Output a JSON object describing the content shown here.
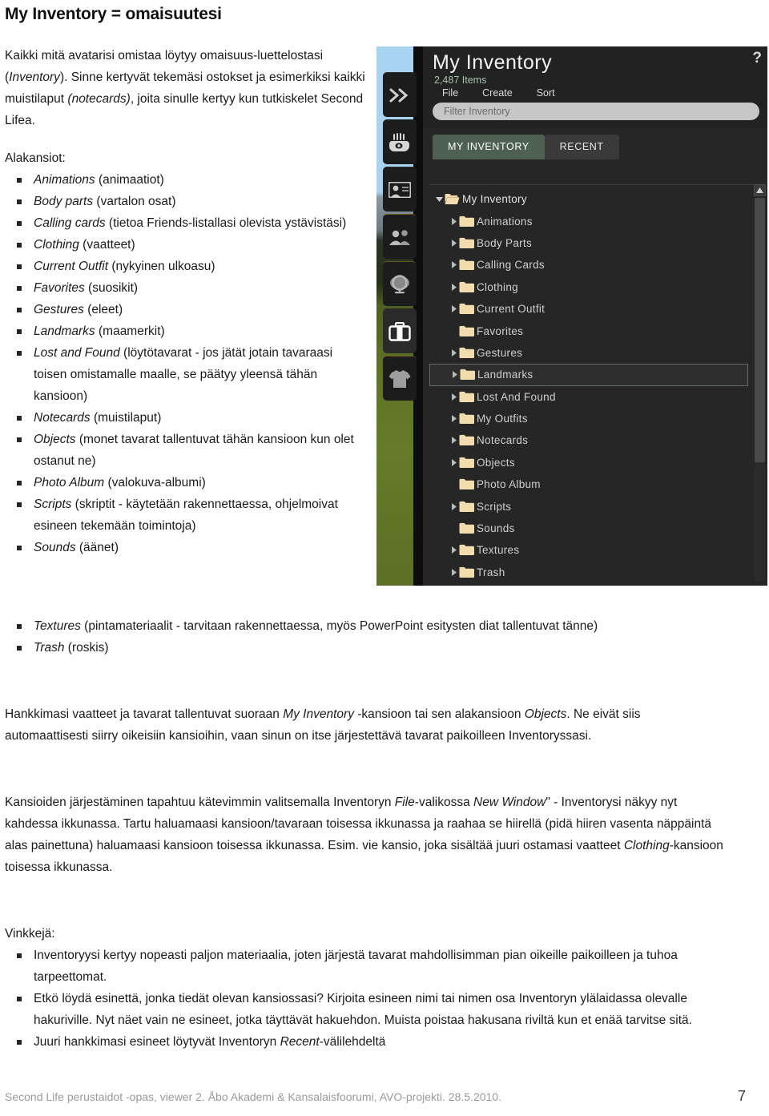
{
  "document": {
    "title": "My Inventory = omaisuutesi",
    "intro_paragraph": "Kaikki mitä avatarisi omistaa löytyy omaisuus-luettelostasi (Inventory). Sinne kertyvät tekemäsi ostokset ja esimerkiksi kaikki muistilaput (notecards), joita sinulle kertyy kun tutkiskelet Second Lifea.",
    "subfolders_label": "Alakansiot:",
    "tips_label": "Vinkkejä:"
  },
  "subfolder_bullets": [
    {
      "term": "Animations",
      "rest": " (animaatiot)"
    },
    {
      "term": "Body parts",
      "rest": " (vartalon osat)"
    },
    {
      "term": "Calling cards",
      "rest": " (tietoa Friends-listallasi olevista ystävistäsi)"
    },
    {
      "term": "Clothing",
      "rest": " (vaatteet)"
    },
    {
      "term": "Current Outfit",
      "rest": " (nykyinen ulkoasu)"
    },
    {
      "term": "Favorites",
      "rest": " (suosikit)"
    },
    {
      "term": "Gestures",
      "rest": " (eleet)"
    },
    {
      "term": "Landmarks",
      "rest": " (maamerkit)"
    },
    {
      "term": "Lost and Found",
      "rest": " (löytötavarat - jos jätät jotain tavaraasi toisen omistamalle maalle, se päätyy yleensä tähän kansioon)"
    },
    {
      "term": "Notecards",
      "rest": " (muistilaput)"
    },
    {
      "term": "Objects",
      "rest": " (monet tavarat tallentuvat tähän kansioon kun olet ostanut ne)"
    },
    {
      "term": "Photo Album",
      "rest": " (valokuva-albumi)"
    },
    {
      "term": "Scripts",
      "rest": " (skriptit - käytetään rakennettaessa, ohjelmoivat esineen tekemään toimintoja)"
    },
    {
      "term": "Sounds",
      "rest": " (äänet)"
    }
  ],
  "wide_bullets": [
    {
      "term": "Textures",
      "rest": " (pintamateriaalit - tarvitaan rakennettaessa, myös PowerPoint esitysten diat tallentuvat tänne)"
    },
    {
      "term": "Trash",
      "rest": " (roskis)"
    }
  ],
  "body_paragraphs": {
    "p1_a": "Hankkimasi vaatteet ja tavarat tallentuvat suoraan ",
    "p1_em1": "My Inventory",
    "p1_b": " -kansioon tai sen alakansioon ",
    "p1_em2": "Objects",
    "p1_c": ". Ne eivät siis automaattisesti siirry oikeisiin kansioihin, vaan sinun on itse järjestettävä tavarat paikoilleen Inventoryssasi.",
    "p2_a": "Kansioiden järjestäminen tapahtuu kätevimmin valitsemalla Inventoryn ",
    "p2_em1": "File",
    "p2_b": "-valikossa ",
    "p2_em2": "New Window",
    "p2_c": "\" - Inventorysi näkyy nyt kahdessa ikkunassa. Tartu haluamaasi kansioon/tavaraan toisessa ikkunassa ja raahaa se hiirellä (pidä hiiren vasenta näppäintä alas painettuna) haluamaasi kansioon toisessa ikkunassa. Esim. vie kansio, joka sisältää juuri ostamasi vaatteet ",
    "p2_em3": "Clothing",
    "p2_d": "-kansioon toisessa ikkunassa."
  },
  "tips_bullets": [
    {
      "pre": "Inventoryysi kertyy nopeasti paljon materiaalia, joten järjestä tavarat mahdollisimman pian oikeille paikoilleen ja tuhoa tarpeettomat.",
      "em": "",
      "post": ""
    },
    {
      "pre": "Etkö löydä esinettä, jonka tiedät olevan kansiossasi? Kirjoita esineen nimi tai nimen osa Inventoryn ylälaidassa olevalle hakuriville. Nyt näet vain ne esineet, jotka täyttävät hakuehdon. Muista poistaa hakusana riviltä kun et enää tarvitse sitä.",
      "em": "",
      "post": ""
    },
    {
      "pre": "Juuri hankkimasi esineet löytyvät Inventoryn ",
      "em": "Recent",
      "post": "-välilehdeltä"
    }
  ],
  "footer": {
    "text": "Second Life perustaidot -opas, viewer 2. Åbo Akademi & Kansalaisfoorumi, AVO-projekti. 28.5.2010.",
    "page_number": "7"
  },
  "sl_window": {
    "title": "My Inventory",
    "item_count": "2,487 Items",
    "help_glyph": "?",
    "menu": [
      "File",
      "Create",
      "Sort"
    ],
    "filter_placeholder": "Filter Inventory",
    "tabs": [
      {
        "label": "MY INVENTORY",
        "active": true
      },
      {
        "label": "RECENT",
        "active": false
      }
    ],
    "colors": {
      "floater_bg": "#262626",
      "header_bg": "#222222",
      "active_tab": "#4e6050",
      "inactive_tab": "#3a3a3a",
      "folder": "#f2dcae",
      "count_text": "#a7c3ae"
    },
    "sidebar_icons": [
      "chevrons-right-icon",
      "hand-eye-icon",
      "profile-card-icon",
      "people-icon",
      "world-globe-icon",
      "inventory-suitcase-icon",
      "appearance-shirt-icon"
    ],
    "tree": [
      {
        "label": "My Inventory",
        "depth": 0,
        "expanded": true,
        "has_arrow": true,
        "selected": false
      },
      {
        "label": "Animations",
        "depth": 1,
        "expanded": false,
        "has_arrow": true,
        "selected": false
      },
      {
        "label": "Body Parts",
        "depth": 1,
        "expanded": false,
        "has_arrow": true,
        "selected": false
      },
      {
        "label": "Calling Cards",
        "depth": 1,
        "expanded": false,
        "has_arrow": true,
        "selected": false
      },
      {
        "label": "Clothing",
        "depth": 1,
        "expanded": false,
        "has_arrow": true,
        "selected": false
      },
      {
        "label": "Current Outfit",
        "depth": 1,
        "expanded": false,
        "has_arrow": true,
        "selected": false
      },
      {
        "label": "Favorites",
        "depth": 1,
        "expanded": false,
        "has_arrow": false,
        "selected": false
      },
      {
        "label": "Gestures",
        "depth": 1,
        "expanded": false,
        "has_arrow": true,
        "selected": false
      },
      {
        "label": "Landmarks",
        "depth": 1,
        "expanded": false,
        "has_arrow": true,
        "selected": true
      },
      {
        "label": "Lost And Found",
        "depth": 1,
        "expanded": false,
        "has_arrow": true,
        "selected": false
      },
      {
        "label": "My Outfits",
        "depth": 1,
        "expanded": false,
        "has_arrow": true,
        "selected": false
      },
      {
        "label": "Notecards",
        "depth": 1,
        "expanded": false,
        "has_arrow": true,
        "selected": false
      },
      {
        "label": "Objects",
        "depth": 1,
        "expanded": false,
        "has_arrow": true,
        "selected": false
      },
      {
        "label": "Photo Album",
        "depth": 1,
        "expanded": false,
        "has_arrow": false,
        "selected": false
      },
      {
        "label": "Scripts",
        "depth": 1,
        "expanded": false,
        "has_arrow": true,
        "selected": false
      },
      {
        "label": "Sounds",
        "depth": 1,
        "expanded": false,
        "has_arrow": false,
        "selected": false
      },
      {
        "label": "Textures",
        "depth": 1,
        "expanded": false,
        "has_arrow": true,
        "selected": false
      },
      {
        "label": "Trash",
        "depth": 1,
        "expanded": false,
        "has_arrow": true,
        "selected": false
      }
    ]
  }
}
